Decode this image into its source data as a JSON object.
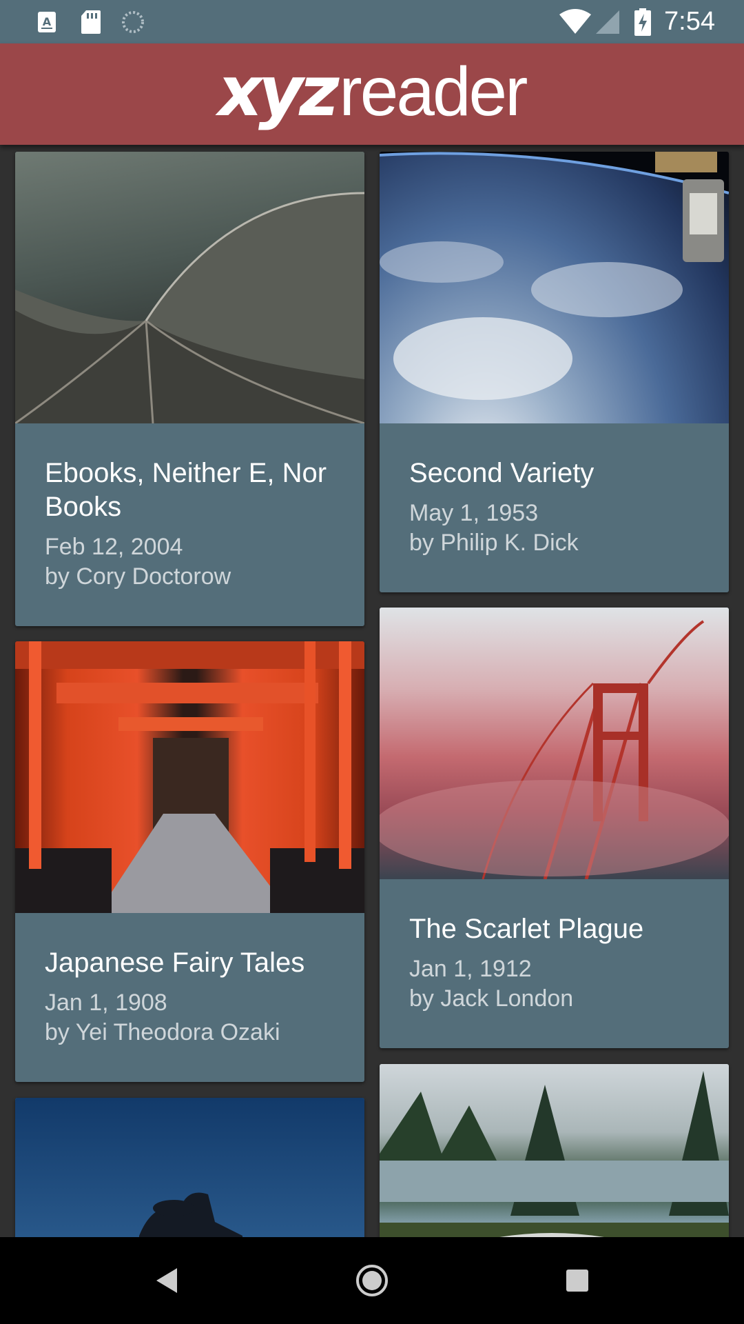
{
  "status_bar": {
    "time": "7:54",
    "icons": [
      "a-notification-icon",
      "sd-card-icon",
      "sync-icon",
      "wifi-icon",
      "cell-signal-icon",
      "battery-charging-icon"
    ]
  },
  "app_bar": {
    "logo_bold": "xyz",
    "logo_light": "reader"
  },
  "articles": [
    {
      "title": "Ebooks, Neither E, Nor Books",
      "date": "Feb 12, 2004",
      "author": "by Cory Doctorow",
      "image": "opera-house-roof"
    },
    {
      "title": "Second Variety",
      "date": "May 1, 1953",
      "author": "by Philip K. Dick",
      "image": "earth-from-space"
    },
    {
      "title": "Japanese Fairy Tales",
      "date": "Jan 1, 1908",
      "author": "by Yei Theodora Ozaki",
      "image": "torii-gates"
    },
    {
      "title": "The Scarlet Plague",
      "date": "Jan 1, 1912",
      "author": "by Jack London",
      "image": "golden-gate-fog"
    },
    {
      "title": "",
      "date": "",
      "author": "",
      "image": "night-silhouette"
    },
    {
      "title": "",
      "date": "",
      "author": "",
      "image": "lake-forest"
    }
  ],
  "nav_bar": {
    "buttons": [
      "back-icon",
      "home-icon",
      "recents-icon"
    ]
  },
  "colors": {
    "status_bar": "#546e7a",
    "app_bar": "#9b4749",
    "card": "#546e7a",
    "background": "#303030"
  }
}
